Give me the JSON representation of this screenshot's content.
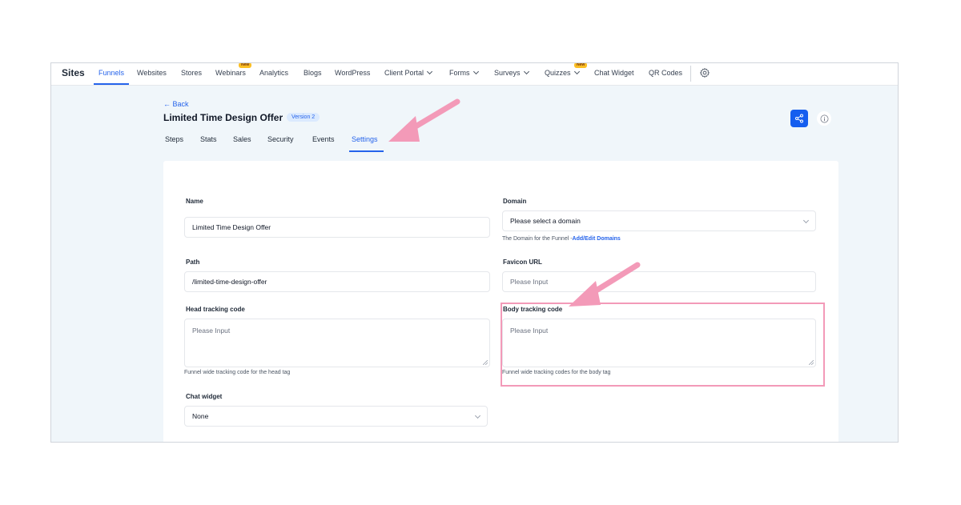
{
  "nav": {
    "brand": "Sites",
    "items": [
      {
        "label": "Funnels",
        "active": true
      },
      {
        "label": "Websites"
      },
      {
        "label": "Stores"
      },
      {
        "label": "Webinars",
        "badge": "New"
      },
      {
        "label": "Analytics"
      },
      {
        "label": "Blogs"
      },
      {
        "label": "WordPress"
      },
      {
        "label": "Client Portal",
        "dropdown": true
      },
      {
        "label": "Forms",
        "dropdown": true
      },
      {
        "label": "Surveys",
        "dropdown": true
      },
      {
        "label": "Quizzes",
        "dropdown": true,
        "badge": "New"
      },
      {
        "label": "Chat Widget"
      },
      {
        "label": "QR Codes"
      }
    ],
    "settings_icon": "gear-icon"
  },
  "header": {
    "back_label": "← Back",
    "title": "Limited Time Design Offer",
    "version_badge": "Version 2",
    "share_icon": "share-icon",
    "info_icon": "info-icon"
  },
  "tabs": [
    "Steps",
    "Stats",
    "Sales",
    "Security",
    "Events",
    "Settings"
  ],
  "active_tab": "Settings",
  "form": {
    "name": {
      "label": "Name",
      "value": "Limited Time Design Offer"
    },
    "domain": {
      "label": "Domain",
      "placeholder": "Please select a domain",
      "help": "The Domain for the Funnel -",
      "help_link": "Add/Edit Domains"
    },
    "path": {
      "label": "Path",
      "value": "/limited-time-design-offer"
    },
    "favicon": {
      "label": "Favicon URL",
      "placeholder": "Please Input"
    },
    "head_tracking": {
      "label": "Head tracking code",
      "placeholder": "Please Input",
      "help": "Funnel wide tracking code for the head tag"
    },
    "body_tracking": {
      "label": "Body tracking code",
      "placeholder": "Please Input",
      "help": "Funnel wide tracking codes for the body tag"
    },
    "chat_widget": {
      "label": "Chat widget",
      "value": "None"
    }
  },
  "colors": {
    "accent": "#2563eb",
    "annotation": "#f39ab8",
    "badge_new": "#fbbf24",
    "page_bg": "#f0f6fa"
  }
}
